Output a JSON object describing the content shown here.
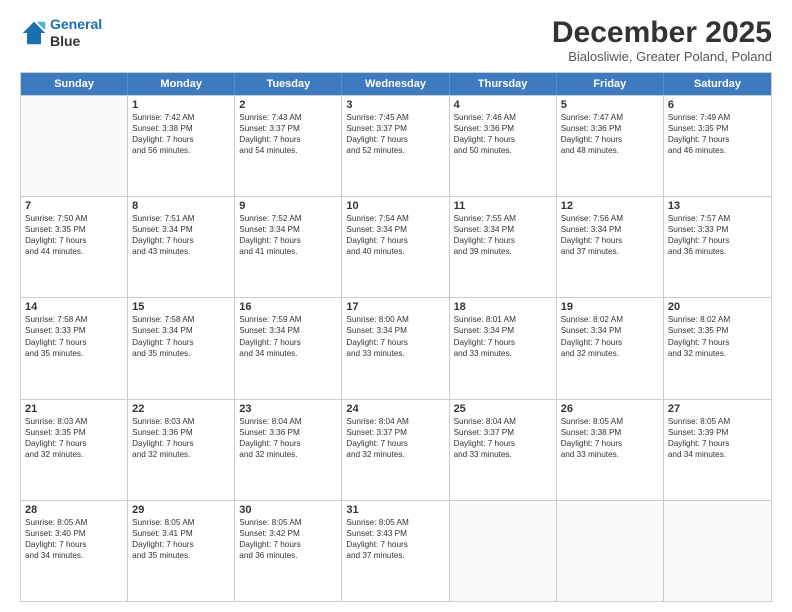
{
  "header": {
    "logo_line1": "General",
    "logo_line2": "Blue",
    "month": "December 2025",
    "location": "Bialosliwie, Greater Poland, Poland"
  },
  "days_of_week": [
    "Sunday",
    "Monday",
    "Tuesday",
    "Wednesday",
    "Thursday",
    "Friday",
    "Saturday"
  ],
  "rows": [
    [
      {
        "day": "",
        "lines": []
      },
      {
        "day": "1",
        "lines": [
          "Sunrise: 7:42 AM",
          "Sunset: 3:38 PM",
          "Daylight: 7 hours",
          "and 56 minutes."
        ]
      },
      {
        "day": "2",
        "lines": [
          "Sunrise: 7:43 AM",
          "Sunset: 3:37 PM",
          "Daylight: 7 hours",
          "and 54 minutes."
        ]
      },
      {
        "day": "3",
        "lines": [
          "Sunrise: 7:45 AM",
          "Sunset: 3:37 PM",
          "Daylight: 7 hours",
          "and 52 minutes."
        ]
      },
      {
        "day": "4",
        "lines": [
          "Sunrise: 7:46 AM",
          "Sunset: 3:36 PM",
          "Daylight: 7 hours",
          "and 50 minutes."
        ]
      },
      {
        "day": "5",
        "lines": [
          "Sunrise: 7:47 AM",
          "Sunset: 3:36 PM",
          "Daylight: 7 hours",
          "and 48 minutes."
        ]
      },
      {
        "day": "6",
        "lines": [
          "Sunrise: 7:49 AM",
          "Sunset: 3:35 PM",
          "Daylight: 7 hours",
          "and 46 minutes."
        ]
      }
    ],
    [
      {
        "day": "7",
        "lines": [
          "Sunrise: 7:50 AM",
          "Sunset: 3:35 PM",
          "Daylight: 7 hours",
          "and 44 minutes."
        ]
      },
      {
        "day": "8",
        "lines": [
          "Sunrise: 7:51 AM",
          "Sunset: 3:34 PM",
          "Daylight: 7 hours",
          "and 43 minutes."
        ]
      },
      {
        "day": "9",
        "lines": [
          "Sunrise: 7:52 AM",
          "Sunset: 3:34 PM",
          "Daylight: 7 hours",
          "and 41 minutes."
        ]
      },
      {
        "day": "10",
        "lines": [
          "Sunrise: 7:54 AM",
          "Sunset: 3:34 PM",
          "Daylight: 7 hours",
          "and 40 minutes."
        ]
      },
      {
        "day": "11",
        "lines": [
          "Sunrise: 7:55 AM",
          "Sunset: 3:34 PM",
          "Daylight: 7 hours",
          "and 39 minutes."
        ]
      },
      {
        "day": "12",
        "lines": [
          "Sunrise: 7:56 AM",
          "Sunset: 3:34 PM",
          "Daylight: 7 hours",
          "and 37 minutes."
        ]
      },
      {
        "day": "13",
        "lines": [
          "Sunrise: 7:57 AM",
          "Sunset: 3:33 PM",
          "Daylight: 7 hours",
          "and 36 minutes."
        ]
      }
    ],
    [
      {
        "day": "14",
        "lines": [
          "Sunrise: 7:58 AM",
          "Sunset: 3:33 PM",
          "Daylight: 7 hours",
          "and 35 minutes."
        ]
      },
      {
        "day": "15",
        "lines": [
          "Sunrise: 7:58 AM",
          "Sunset: 3:34 PM",
          "Daylight: 7 hours",
          "and 35 minutes."
        ]
      },
      {
        "day": "16",
        "lines": [
          "Sunrise: 7:59 AM",
          "Sunset: 3:34 PM",
          "Daylight: 7 hours",
          "and 34 minutes."
        ]
      },
      {
        "day": "17",
        "lines": [
          "Sunrise: 8:00 AM",
          "Sunset: 3:34 PM",
          "Daylight: 7 hours",
          "and 33 minutes."
        ]
      },
      {
        "day": "18",
        "lines": [
          "Sunrise: 8:01 AM",
          "Sunset: 3:34 PM",
          "Daylight: 7 hours",
          "and 33 minutes."
        ]
      },
      {
        "day": "19",
        "lines": [
          "Sunrise: 8:02 AM",
          "Sunset: 3:34 PM",
          "Daylight: 7 hours",
          "and 32 minutes."
        ]
      },
      {
        "day": "20",
        "lines": [
          "Sunrise: 8:02 AM",
          "Sunset: 3:35 PM",
          "Daylight: 7 hours",
          "and 32 minutes."
        ]
      }
    ],
    [
      {
        "day": "21",
        "lines": [
          "Sunrise: 8:03 AM",
          "Sunset: 3:35 PM",
          "Daylight: 7 hours",
          "and 32 minutes."
        ]
      },
      {
        "day": "22",
        "lines": [
          "Sunrise: 8:03 AM",
          "Sunset: 3:36 PM",
          "Daylight: 7 hours",
          "and 32 minutes."
        ]
      },
      {
        "day": "23",
        "lines": [
          "Sunrise: 8:04 AM",
          "Sunset: 3:36 PM",
          "Daylight: 7 hours",
          "and 32 minutes."
        ]
      },
      {
        "day": "24",
        "lines": [
          "Sunrise: 8:04 AM",
          "Sunset: 3:37 PM",
          "Daylight: 7 hours",
          "and 32 minutes."
        ]
      },
      {
        "day": "25",
        "lines": [
          "Sunrise: 8:04 AM",
          "Sunset: 3:37 PM",
          "Daylight: 7 hours",
          "and 33 minutes."
        ]
      },
      {
        "day": "26",
        "lines": [
          "Sunrise: 8:05 AM",
          "Sunset: 3:38 PM",
          "Daylight: 7 hours",
          "and 33 minutes."
        ]
      },
      {
        "day": "27",
        "lines": [
          "Sunrise: 8:05 AM",
          "Sunset: 3:39 PM",
          "Daylight: 7 hours",
          "and 34 minutes."
        ]
      }
    ],
    [
      {
        "day": "28",
        "lines": [
          "Sunrise: 8:05 AM",
          "Sunset: 3:40 PM",
          "Daylight: 7 hours",
          "and 34 minutes."
        ]
      },
      {
        "day": "29",
        "lines": [
          "Sunrise: 8:05 AM",
          "Sunset: 3:41 PM",
          "Daylight: 7 hours",
          "and 35 minutes."
        ]
      },
      {
        "day": "30",
        "lines": [
          "Sunrise: 8:05 AM",
          "Sunset: 3:42 PM",
          "Daylight: 7 hours",
          "and 36 minutes."
        ]
      },
      {
        "day": "31",
        "lines": [
          "Sunrise: 8:05 AM",
          "Sunset: 3:43 PM",
          "Daylight: 7 hours",
          "and 37 minutes."
        ]
      },
      {
        "day": "",
        "lines": []
      },
      {
        "day": "",
        "lines": []
      },
      {
        "day": "",
        "lines": []
      }
    ]
  ]
}
